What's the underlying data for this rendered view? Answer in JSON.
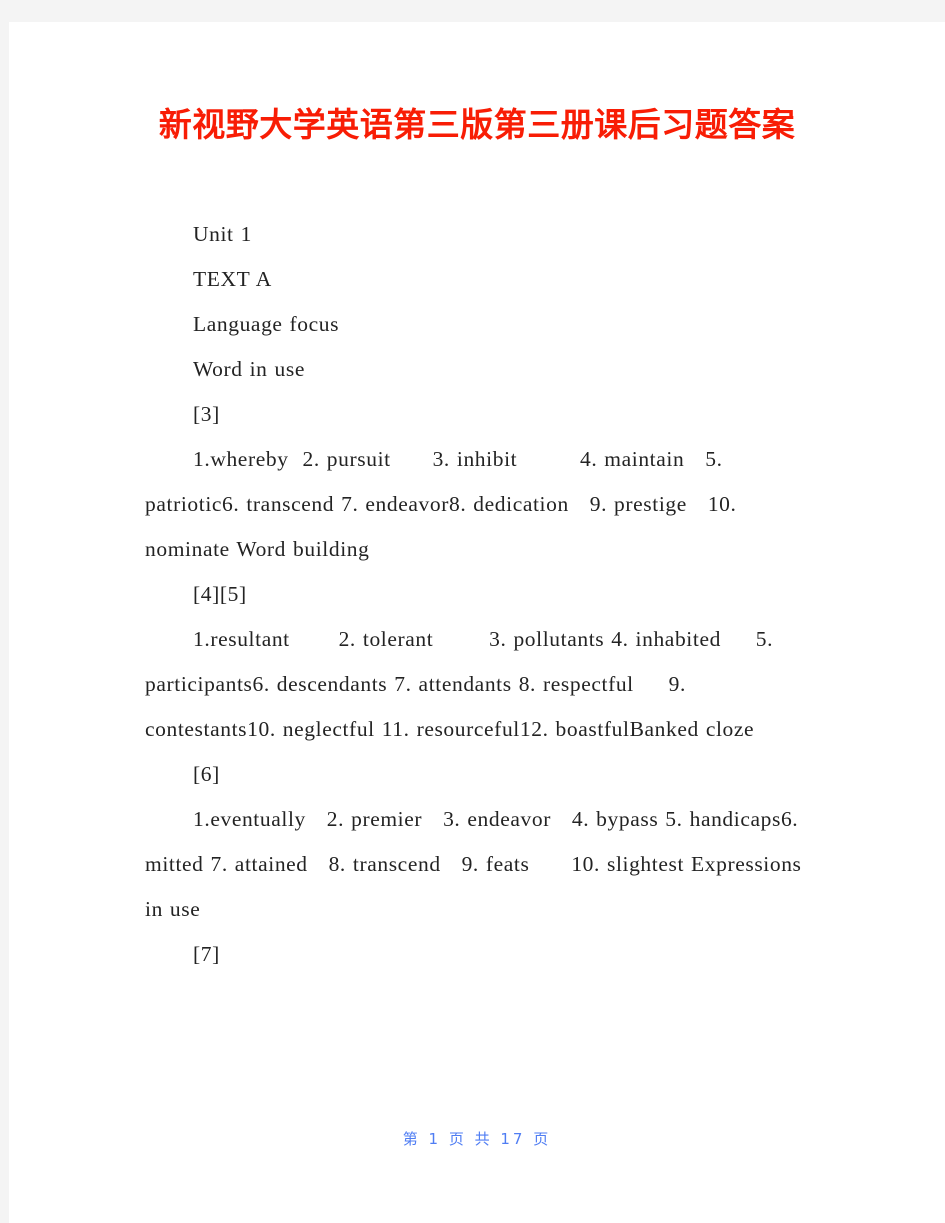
{
  "document": {
    "title": "新视野大学英语第三版第三册课后习题答案",
    "title_color": "#f81d05",
    "body_color": "#232323",
    "page_background": "#ffffff",
    "canvas_background": "#f4f4f4"
  },
  "body": {
    "paragraphs": [
      {
        "id": "unit",
        "text": "Unit 1"
      },
      {
        "id": "text-a",
        "text": "TEXT A"
      },
      {
        "id": "language-focus",
        "text": "Language focus"
      },
      {
        "id": "word-in-use",
        "text": "Word in use"
      },
      {
        "id": "marker-3",
        "text": "[3]"
      },
      {
        "id": "answers-3",
        "text": "1.whereby  2. pursuit      3. inhibit         4. maintain   5. patriotic6. transcend 7. endeavor8. dedication   9. prestige   10. nominate Word building"
      },
      {
        "id": "marker-4-5",
        "text": "[4][5]"
      },
      {
        "id": "answers-4-5",
        "text": "1.resultant       2. tolerant        3. pollutants 4. inhabited     5. participants6. descendants 7. attendants 8. respectful     9. contestants10. neglectful 11. resourceful12. boastfulBanked cloze"
      },
      {
        "id": "marker-6",
        "text": "[6]"
      },
      {
        "id": "answers-6",
        "text": "1.eventually   2. premier   3. endeavor   4. bypass 5. handicaps6. mitted 7. attained   8. transcend   9. feats      10. slightest Expressions in use"
      },
      {
        "id": "marker-7",
        "text": "[7]"
      }
    ]
  },
  "footer": {
    "text": "第 1 页 共 17 页",
    "color": "#4f7df3",
    "current_page": "1",
    "total_pages": "17"
  }
}
